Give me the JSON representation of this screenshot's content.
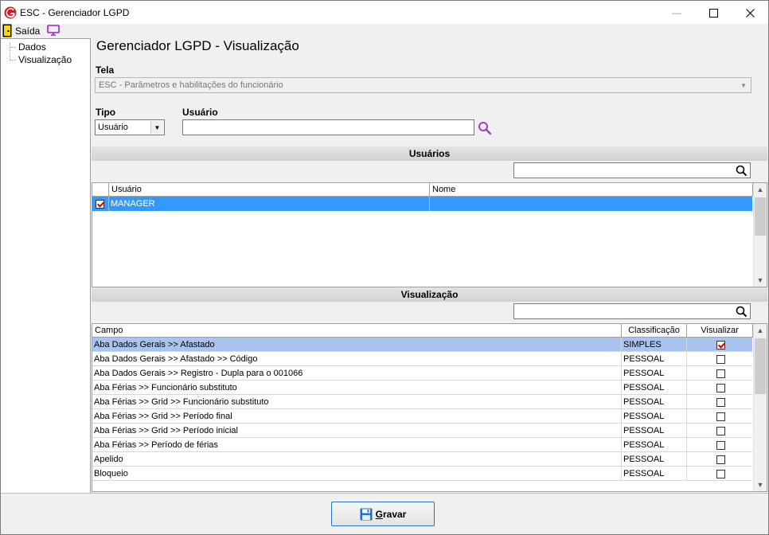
{
  "window": {
    "title": "ESC - Gerenciador LGPD",
    "minimize_glyph": "—",
    "maximize_glyph": "☐",
    "close_glyph": "✕"
  },
  "menu": {
    "exit_label": "Saída",
    "exit_icon": "door-exit-icon",
    "screen_icon": "monitor-icon"
  },
  "tree": {
    "items": [
      {
        "label": "Dados"
      },
      {
        "label": "Visualização"
      }
    ]
  },
  "main": {
    "heading": "Gerenciador LGPD - Visualização",
    "tela_label": "Tela",
    "tela_value": "ESC - Parâmetros e habilitações do funcionário",
    "tipo_label": "Tipo",
    "tipo_value": "Usuário",
    "usuario_label": "Usuário",
    "usuario_value": ""
  },
  "users_section": {
    "title": "Usuários",
    "search_value": "",
    "columns": [
      "Usuário",
      "Nome"
    ],
    "rows": [
      {
        "checked": true,
        "usuario": "MANAGER",
        "nome": "",
        "selected": true
      }
    ]
  },
  "view_section": {
    "title": "Visualização",
    "search_value": "",
    "columns": [
      "Campo",
      "Classificação",
      "Visualizar"
    ],
    "rows": [
      {
        "campo": "Aba Dados Gerais >> Afastado",
        "classificacao": "SIMPLES",
        "visualizar": true,
        "selected": true
      },
      {
        "campo": "Aba Dados Gerais >> Afastado >> Código",
        "classificacao": "PESSOAL",
        "visualizar": false
      },
      {
        "campo": "Aba Dados Gerais >> Registro - Dupla para o 001066",
        "classificacao": "PESSOAL",
        "visualizar": false
      },
      {
        "campo": "Aba Férias >> Funcionário substituto",
        "classificacao": "PESSOAL",
        "visualizar": false
      },
      {
        "campo": "Aba Férias >> Grid >> Funcionário substituto",
        "classificacao": "PESSOAL",
        "visualizar": false
      },
      {
        "campo": "Aba Férias >> Grid >> Período final",
        "classificacao": "PESSOAL",
        "visualizar": false
      },
      {
        "campo": "Aba Férias >> Grid >> Período inicial",
        "classificacao": "PESSOAL",
        "visualizar": false
      },
      {
        "campo": "Aba Férias >> Período de férias",
        "classificacao": "PESSOAL",
        "visualizar": false
      },
      {
        "campo": "Apelido",
        "classificacao": "PESSOAL",
        "visualizar": false
      },
      {
        "campo": "Bloqueio",
        "classificacao": "PESSOAL",
        "visualizar": false
      }
    ]
  },
  "footer": {
    "save_label_accel": "G",
    "save_label_rest": "ravar"
  },
  "colors": {
    "selection_blue": "#3399ff",
    "selection_light": "#a9c3ee",
    "accent_red": "#d00000",
    "search_purple": "#9b3fd1"
  }
}
